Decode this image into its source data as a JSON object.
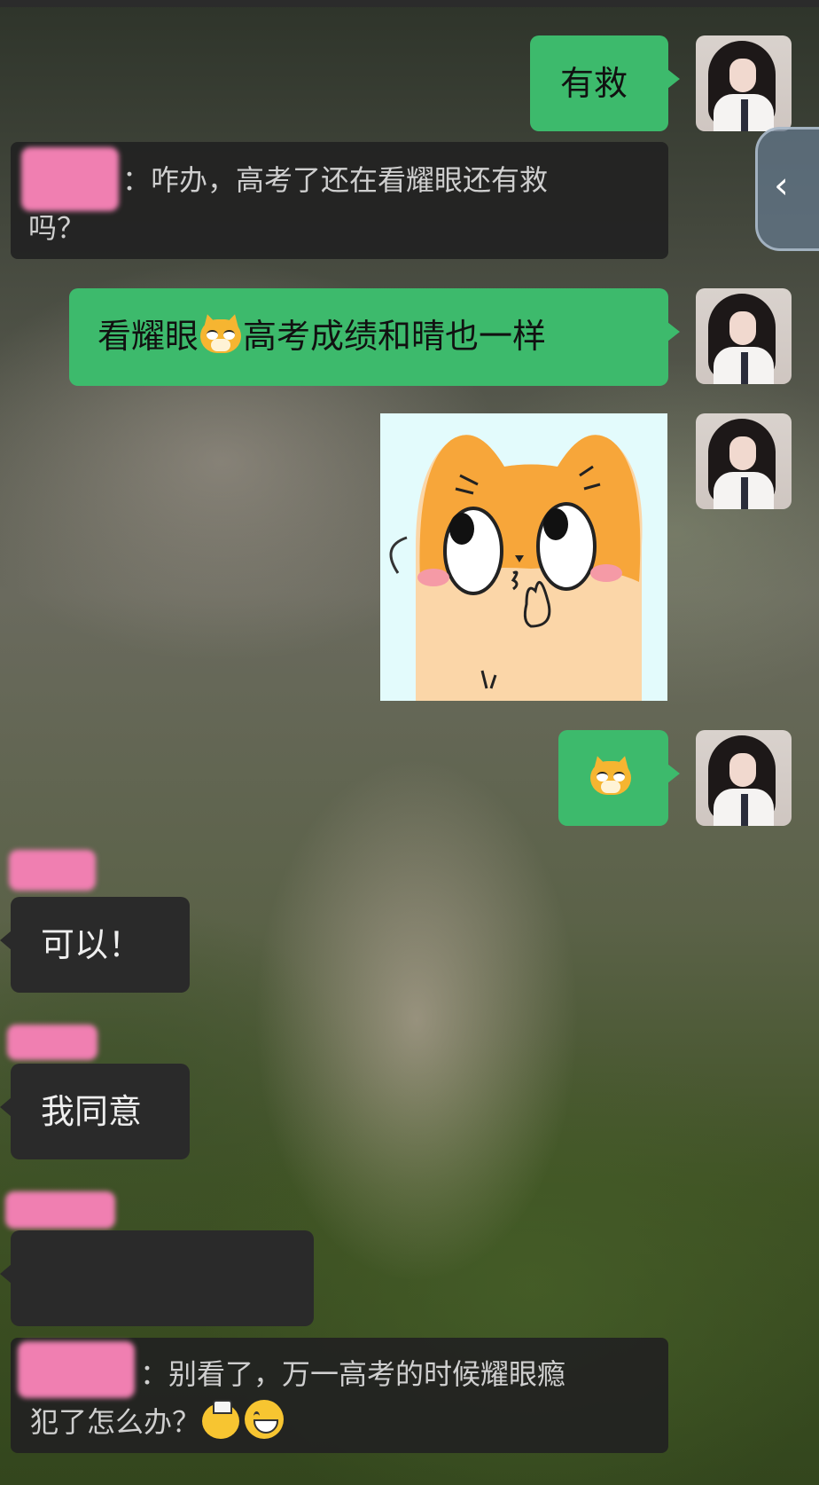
{
  "messages": {
    "m1": {
      "text": "有救"
    },
    "q1": {
      "text": "咋办，高考了还在看耀眼还有救吗？",
      "sep": "：",
      "line1": "咋办，高考了还在看耀眼还有救",
      "line2": "吗？"
    },
    "m2": {
      "before": "看耀眼",
      "after": "高考成绩和晴也一样",
      "emoji": "doge-cat-emoji"
    },
    "m3": {
      "sticker": "orange-cat-sticker"
    },
    "m4": {
      "emoji": "doge-cat-emoji"
    },
    "t1": {
      "text": "可以！"
    },
    "t2": {
      "text": "我同意"
    },
    "t3": {
      "text": ""
    },
    "q2": {
      "sep": "：",
      "line1": "别看了，万一高考的时候耀眼瘾",
      "line2": "犯了怎么办？",
      "emoji1": "sleepy-lamp-emoji",
      "emoji2": "grin-emoji"
    }
  },
  "side_tab": {
    "icon": "chevron-left-icon",
    "glyph": "‹"
  },
  "colors": {
    "me_bubble": "#3dba6c",
    "them_bubble": "#2a2a2a",
    "redaction": "#f07fb1"
  }
}
